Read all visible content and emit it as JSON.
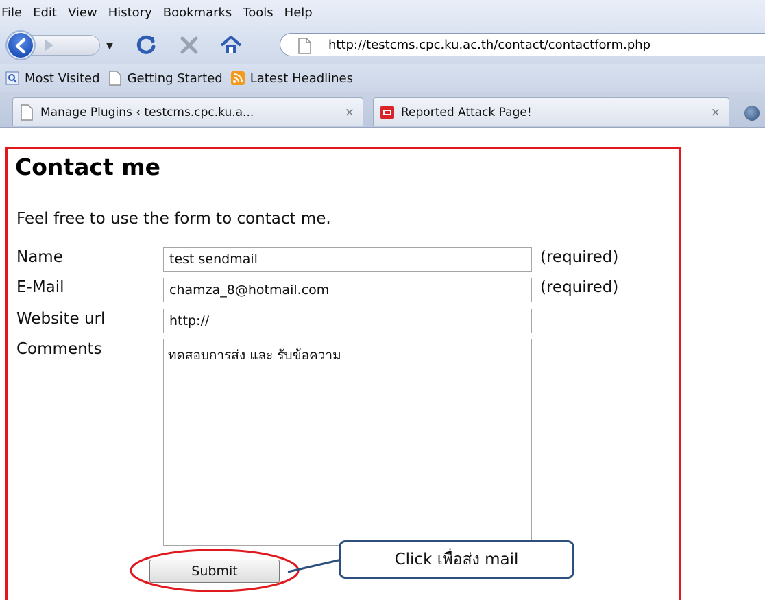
{
  "menubar": {
    "items": [
      "File",
      "Edit",
      "View",
      "History",
      "Bookmarks",
      "Tools",
      "Help"
    ]
  },
  "navbar": {
    "url": "http://testcms.cpc.ku.ac.th/contact/contactform.php",
    "icons": [
      "back-arrow-icon",
      "forward-arrow-icon",
      "reload-icon",
      "stop-icon",
      "home-icon",
      "page-icon"
    ]
  },
  "bookmarks": {
    "items": [
      "Most Visited",
      "Getting Started",
      "Latest Headlines"
    ]
  },
  "tabs": [
    {
      "label": "Manage Plugins ‹ testcms.cpc.ku.a...",
      "close": "×"
    },
    {
      "label": "Reported Attack Page!",
      "close": "×"
    }
  ],
  "page": {
    "title": "Contact me",
    "intro": "Feel free to use the form to contact me.",
    "fields": {
      "name_label": "Name",
      "name_value": "test sendmail",
      "email_label": "E-Mail",
      "email_value": "chamza_8@hotmail.com",
      "website_label": "Website url",
      "website_value": "http://",
      "comments_label": "Comments",
      "comments_value": "ทดสอบการส่ง และ รับข้อความ"
    },
    "required_text": "(required)",
    "submit_label": "Submit"
  },
  "annotation": {
    "callout_text": "Click เพื่อส่ง mail",
    "highlight_color": "#e0191f",
    "callout_border_color": "#2d4f7c"
  }
}
